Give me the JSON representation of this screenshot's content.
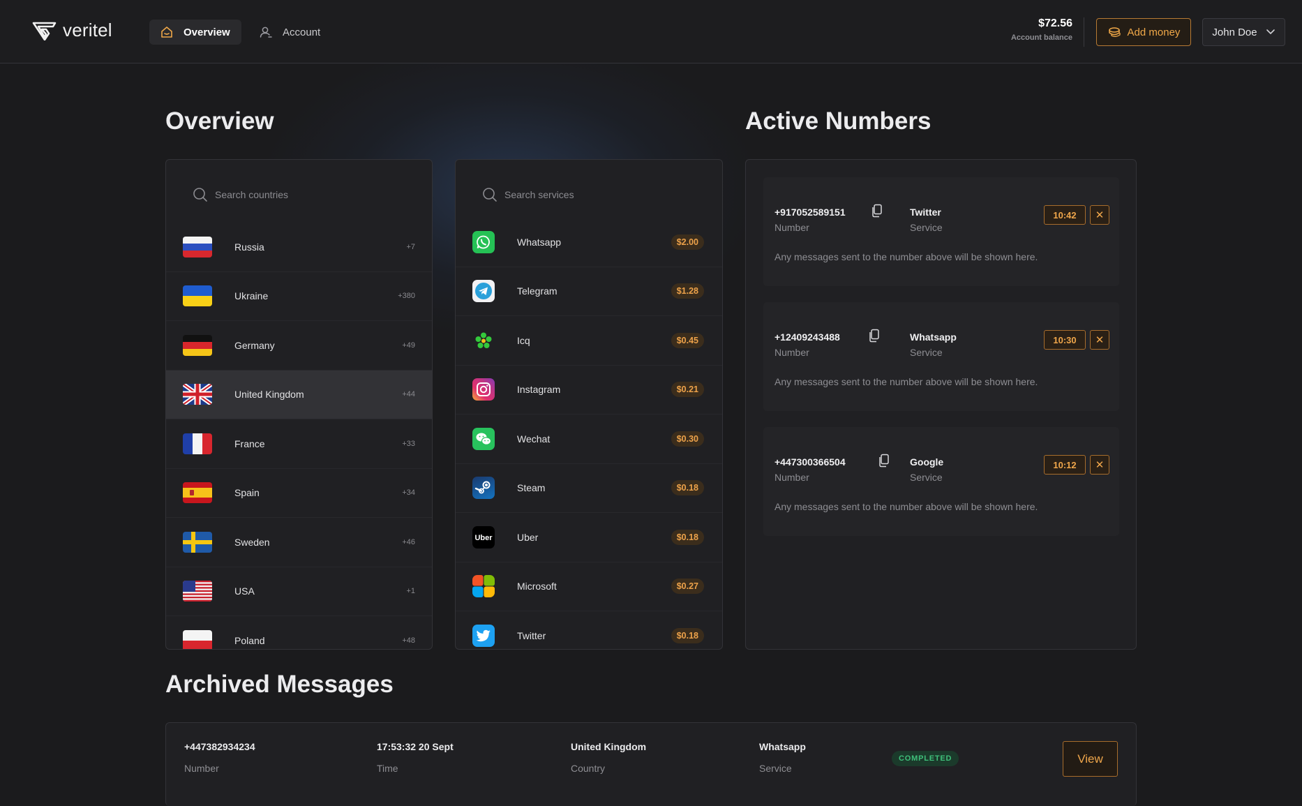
{
  "app": {
    "name": "veritel"
  },
  "nav": {
    "overview": "Overview",
    "account": "Account"
  },
  "header": {
    "balance": "$72.56",
    "balance_label": "Account balance",
    "add_money": "Add money",
    "user": "John Doe"
  },
  "sections": {
    "overview": "Overview",
    "active": "Active Numbers",
    "archived": "Archived Messages"
  },
  "countries": {
    "placeholder": "Search countries",
    "items": [
      {
        "name": "Russia",
        "code": "+7"
      },
      {
        "name": "Ukraine",
        "code": "+380"
      },
      {
        "name": "Germany",
        "code": "+49"
      },
      {
        "name": "United Kingdom",
        "code": "+44",
        "selected": true
      },
      {
        "name": "France",
        "code": "+33"
      },
      {
        "name": "Spain",
        "code": "+34"
      },
      {
        "name": "Sweden",
        "code": "+46"
      },
      {
        "name": "USA",
        "code": "+1"
      },
      {
        "name": "Poland",
        "code": "+48"
      }
    ]
  },
  "services": {
    "placeholder": "Search services",
    "items": [
      {
        "name": "Whatsapp",
        "price": "$2.00",
        "icon": "whatsapp-icon"
      },
      {
        "name": "Telegram",
        "price": "$1.28",
        "icon": "telegram-icon"
      },
      {
        "name": "Icq",
        "price": "$0.45",
        "icon": "icq-icon"
      },
      {
        "name": "Instagram",
        "price": "$0.21",
        "icon": "instagram-icon"
      },
      {
        "name": "Wechat",
        "price": "$0.30",
        "icon": "wechat-icon"
      },
      {
        "name": "Steam",
        "price": "$0.18",
        "icon": "steam-icon"
      },
      {
        "name": "Uber",
        "price": "$0.18",
        "icon": "uber-icon"
      },
      {
        "name": "Microsoft",
        "price": "$0.27",
        "icon": "microsoft-icon"
      },
      {
        "name": "Twitter",
        "price": "$0.18",
        "icon": "twitter-icon"
      }
    ]
  },
  "active_numbers": [
    {
      "number": "+917052589151",
      "number_label": "Number",
      "service": "Twitter",
      "service_label": "Service",
      "timer": "10:42",
      "message": "Any messages sent to the number above will be shown here."
    },
    {
      "number": "+12409243488",
      "number_label": "Number",
      "service": "Whatsapp",
      "service_label": "Service",
      "timer": "10:30",
      "message": "Any messages sent to the number above will be shown here."
    },
    {
      "number": "+447300366504",
      "number_label": "Number",
      "service": "Google",
      "service_label": "Service",
      "timer": "10:12",
      "message": "Any messages sent to the number above will be shown here."
    }
  ],
  "archived": [
    {
      "number": "+447382934234",
      "number_label": "Number",
      "time": "17:53:32 20 Sept",
      "time_label": "Time",
      "country": "United Kingdom",
      "country_label": "Country",
      "service": "Whatsapp",
      "service_label": "Service",
      "status": "COMPLETED",
      "view": "View"
    }
  ],
  "colors": {
    "accent": "#efa64b",
    "background": "#1b1b1d",
    "panel": "#202023",
    "success": "#3fbf7a"
  }
}
